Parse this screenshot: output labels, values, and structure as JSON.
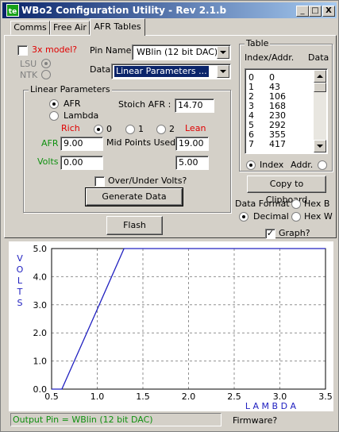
{
  "window": {
    "title": "WBo2 Configuration Utility - Rev 2.1.b",
    "minimize": "_",
    "maximize": "□",
    "close": "X"
  },
  "tabs": [
    "Comms",
    "Free Air",
    "AFR Tables"
  ],
  "model": {
    "x3_label": "3x model?",
    "x3_checked": false,
    "lsu": "LSU",
    "ntk": "NTK"
  },
  "pin": {
    "label": "Pin Name",
    "value": "WBlin (12 bit DAC)"
  },
  "data_select": {
    "label": "Data",
    "value": "Linear Parameters ..."
  },
  "linear": {
    "group_label": "Linear Parameters",
    "afr_option": "AFR",
    "lambda_option": "Lambda",
    "stoich_label": "Stoich AFR :",
    "stoich_value": "14.70",
    "rich": "Rich",
    "lean": "Lean",
    "mid_options": [
      "0",
      "1",
      "2"
    ],
    "mid_selected": "0",
    "afr_label": "AFR",
    "afr_rich": "9.00",
    "mid_label": "Mid Points Used?",
    "afr_lean": "19.00",
    "volts_label": "Volts",
    "volts_rich": "0.00",
    "volts_lean": "5.00",
    "overunder_label": "Over/Under Volts?",
    "generate_button": "Generate Data"
  },
  "flash_button": "Flash",
  "table": {
    "group_label": "Table",
    "col1": "Index/Addr.",
    "col2": "Data",
    "rows": [
      [
        "0",
        "0"
      ],
      [
        "1",
        "43"
      ],
      [
        "2",
        "106"
      ],
      [
        "3",
        "168"
      ],
      [
        "4",
        "230"
      ],
      [
        "5",
        "292"
      ],
      [
        "6",
        "355"
      ],
      [
        "7",
        "417"
      ]
    ],
    "index_label": "Index",
    "addr_label": "Addr.",
    "copy_button": "Copy to Clipboard"
  },
  "format": {
    "label": "Data Format :",
    "hexb": "Hex B",
    "decimal": "Decimal",
    "hexw": "Hex W",
    "graph_label": "Graph?",
    "graph_checked": true
  },
  "chart_data": {
    "type": "line",
    "xlabel": "L A M B D A",
    "ylabel": "V O L T S",
    "xlim": [
      0.5,
      3.5
    ],
    "ylim": [
      0.0,
      5.0
    ],
    "xticks": [
      "0.5",
      "1.0",
      "1.5",
      "2.0",
      "2.5",
      "3.0",
      "3.5"
    ],
    "yticks": [
      "0.0",
      "1.0",
      "2.0",
      "3.0",
      "4.0",
      "5.0"
    ],
    "grid": true,
    "series": [
      {
        "color": "#2020c0",
        "x": [
          0.5,
          0.612,
          1.0,
          1.293,
          3.5
        ],
        "y": [
          0.0,
          0.0,
          2.84,
          5.0,
          5.0
        ]
      }
    ]
  },
  "status": {
    "output_pin": "Output Pin = WBlin (12 bit DAC)",
    "firmware": "Firmware?"
  }
}
